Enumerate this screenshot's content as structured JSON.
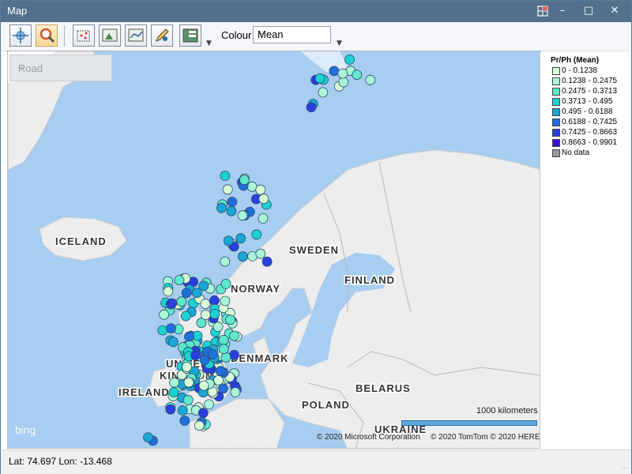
{
  "window": {
    "title": "Map"
  },
  "toolbar": {
    "colour_label": "Colour",
    "colour_value": "Mean"
  },
  "map": {
    "style_selector": "Road",
    "countries": [
      "ICELAND",
      "SWEDEN",
      "FINLAND",
      "NORWAY",
      "UNITED",
      "KINGDOM",
      "DENMARK",
      "IRELAND",
      "BELARUS",
      "POLAND",
      "UKRAINE"
    ],
    "scale_label": "1000 kilometers",
    "copyright_ms": "© 2020 Microsoft Corporation",
    "copyright_tt": "© 2020 TomTom © 2020 HERE",
    "logo": "bing"
  },
  "legend": {
    "title": "Pr/Ph (Mean)",
    "items": [
      {
        "label": "0 - 0.1238",
        "color": "#d6ffd6"
      },
      {
        "label": "0.1238 - 0.2475",
        "color": "#a8f5d8"
      },
      {
        "label": "0.2475 - 0.3713",
        "color": "#5ee8cc"
      },
      {
        "label": "0.3713 - 0.495",
        "color": "#1ad2d2"
      },
      {
        "label": "0.495 - 0.6188",
        "color": "#1aa6d6"
      },
      {
        "label": "0.6188 - 0.7425",
        "color": "#1f6fdc"
      },
      {
        "label": "0.7425 - 0.8663",
        "color": "#2a3fe0"
      },
      {
        "label": "0.8663 - 0.9901",
        "color": "#3a10d8"
      },
      {
        "label": "No data",
        "color": "#9a9a9a"
      }
    ]
  },
  "status": {
    "coords": "Lat: 74.697 Lon: -13.468"
  }
}
